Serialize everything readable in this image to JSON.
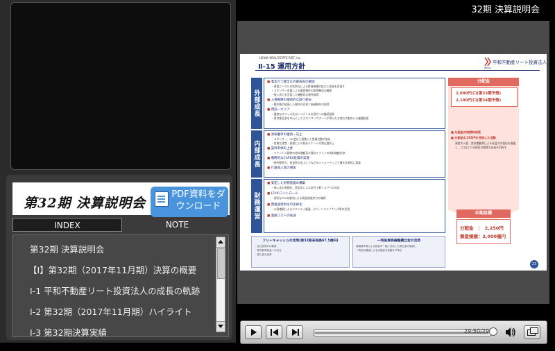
{
  "header": {
    "title": "32期 決算説明会"
  },
  "banner": {
    "title": "第32期 決算説明会",
    "pdf_button": "PDF資料をダウンロード"
  },
  "tabs": {
    "index": "INDEX",
    "note": "NOTE"
  },
  "index_items": [
    "第32期 決算説明会",
    "【I】第32期（2017年11月期）決算の概要",
    "Ⅰ-1 平和不動産リート投資法人の成長の軌跡",
    "Ⅰ-2 第32期（2017年11月期）ハイライト",
    "Ⅰ-3 第32期決算実績"
  ],
  "slide": {
    "company": "HEIWA REAL ESTATE REIT, Inc.",
    "title": "Ⅱ-15 運用方針",
    "logo_text": "平和不動産リート投資法人",
    "logo_sub": "HEIWA",
    "categories": [
      {
        "label": "外部成長",
        "bullets": [
          {
            "text": "着実かつ健全な外部成長の継続",
            "subs": [
              "運用ビークルの効率化による投資規模の拡大と成長を目指す",
              "スポンサー支援による優良物件の取得機会の確保",
              "借入余力を活用した機動的な物件取得"
            ]
          },
          {
            "text": "入替戦略の継続的な取り組み",
            "subs": [
              "築年数の経過した物件の売却と新規物件の取得"
            ]
          },
          {
            "text": "用途・エリア",
            "subs": [
              "優良なオフィス及びレジデンスの双方への継続投資",
              "東京都区部を中心としたスポンサーサポートが得られる地方大都市にも厳選投資"
            ]
          }
        ]
      },
      {
        "label": "内部成長",
        "bullets": [
          {
            "text": "高稼働率の維持・向上",
            "subs": [
              "スポンサー、PM会社と連携した営業活動の強化",
              "良質な運営・管理による既存テナントの満足度向上"
            ]
          },
          {
            "text": "賃料単価の上昇",
            "subs": [
              "テナント入替時の賃料増額及び既存テナントの賃料増額交渉"
            ]
          },
          {
            "text": "戦略的なCAPEX投資の実施",
            "subs": [
              "物件競争力、収益性の向上につながるバリューアップ工事を計画的に実施"
            ]
          },
          {
            "text": "什器収入等の増加",
            "subs": []
          }
        ]
      },
      {
        "label": "財務運営",
        "bullets": [
          {
            "text": "安定した財務基盤の構築",
            "subs": [
              "借入金の長期化、固定化による金利上昇リスクへの対応"
            ]
          },
          {
            "text": "LTVのコントロール",
            "subs": [
              "適切なLTVの維持による資金調達余力の確保"
            ]
          },
          {
            "text": "資金調達手段の多様化",
            "subs": [
              "公募増資によるエクイティ調達、グリーンファイナンス等の活用"
            ]
          },
          {
            "text": "金融コストの低減",
            "subs": []
          }
        ]
      }
    ],
    "sidebar": {
      "distribution_header": "分配金",
      "dist_line1": "2,080円/口(第33期予想)",
      "dist_line2": "2,100円/口(第34期予想)",
      "growth_bullet": "分配金の持続的成長",
      "growth_bullet2": "分配金2,250円を目指した活動",
      "growth_small": "資産の入替、賃料増額等による収益力の強化を推進し、1口当たり分配金の着実な成長を目指す",
      "goal_header": "中期目標",
      "goal_dist": "分配金　：　2,250円",
      "goal_assets": "資産規模：2,000億円"
    },
    "bottom_left": {
      "title": "フリーキャッシュの活用(第32期末残高67.5億円)",
      "lines": [
        "・自己投資口の取得",
        "・物件取得資金への充当",
        "・借入金の返済"
      ]
    },
    "bottom_right": {
      "title": "一時差異等調整積立金の活用",
      "lines": [
        "減損損失等による税会不一致に対応した積立金の取崩し",
        "一時的な要因による分配金の変動を平準化"
      ]
    },
    "page_number": "23"
  },
  "player": {
    "time": "29:50/29:5"
  }
}
